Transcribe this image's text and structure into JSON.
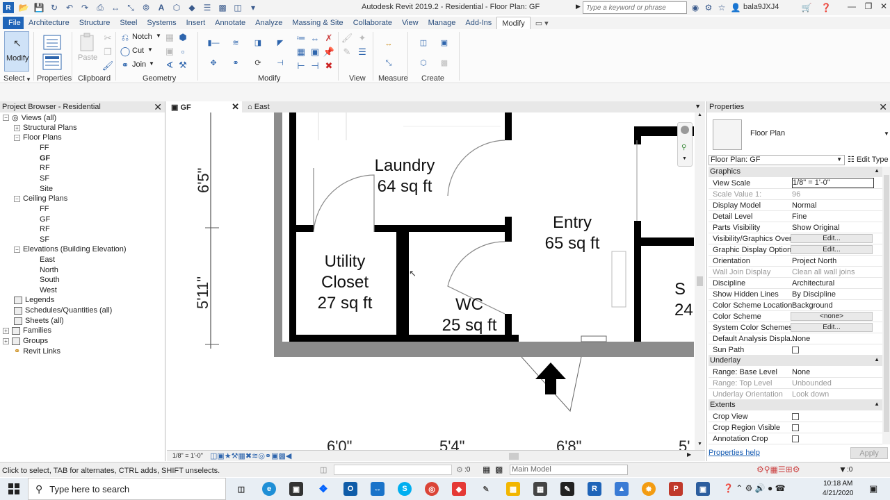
{
  "window": {
    "title": "Autodesk Revit 2019.2 - Residential - Floor Plan: GF",
    "search_placeholder": "Type a keyword or phrase",
    "user": "bala9JXJ4"
  },
  "ribbon": {
    "tabs": [
      "File",
      "Architecture",
      "Structure",
      "Steel",
      "Systems",
      "Insert",
      "Annotate",
      "Analyze",
      "Massing & Site",
      "Collaborate",
      "View",
      "Manage",
      "Add-Ins",
      "Modify"
    ],
    "active_tab": "Modify",
    "modify_label": "Modify",
    "panels": {
      "select": "Select",
      "properties": "Properties",
      "clipboard": "Clipboard",
      "geometry": "Geometry",
      "modify": "Modify",
      "view": "View",
      "measure": "Measure",
      "create": "Create"
    },
    "buttons": {
      "paste": "Paste",
      "notch": "Notch",
      "cut": "Cut",
      "join": "Join"
    }
  },
  "project_browser": {
    "title": "Project Browser - Residential",
    "nodes": [
      {
        "label": "Views (all)"
      },
      {
        "label": "Structural Plans"
      },
      {
        "label": "Floor Plans"
      },
      {
        "label": "FF"
      },
      {
        "label": "GF",
        "active": true
      },
      {
        "label": "RF"
      },
      {
        "label": "SF"
      },
      {
        "label": "Site"
      },
      {
        "label": "Ceiling Plans"
      },
      {
        "label": "FF"
      },
      {
        "label": "GF"
      },
      {
        "label": "RF"
      },
      {
        "label": "SF"
      },
      {
        "label": "Elevations (Building Elevation)"
      },
      {
        "label": "East"
      },
      {
        "label": "North"
      },
      {
        "label": "South"
      },
      {
        "label": "West"
      },
      {
        "label": "Legends"
      },
      {
        "label": "Schedules/Quantities (all)"
      },
      {
        "label": "Sheets (all)"
      },
      {
        "label": "Families"
      },
      {
        "label": "Groups"
      },
      {
        "label": "Revit Links"
      }
    ]
  },
  "doc_tabs": [
    {
      "label": "GF",
      "active": true
    },
    {
      "label": "East",
      "active": false
    }
  ],
  "canvas": {
    "rooms": [
      {
        "name": "Laundry",
        "area": "64 sq ft"
      },
      {
        "name": "Entry",
        "area": "65 sq ft"
      },
      {
        "name": "Utility",
        "name2": "Closet",
        "area": "27 sq ft"
      },
      {
        "name": "WC",
        "area": "25 sq ft"
      },
      {
        "name": "S",
        "area": "24"
      }
    ],
    "dimensions": {
      "v_top": "6'5\"",
      "v_bottom": "5'11\"",
      "h1": "6'0\"",
      "h2": "5'4\"",
      "h3": "6'8\"",
      "h4": "5'"
    }
  },
  "view_control": {
    "scale": "1/8\" = 1'-0\""
  },
  "properties": {
    "title": "Properties",
    "type_name": "Floor Plan",
    "instance": "Floor Plan: GF",
    "edit_type": "Edit Type",
    "groups": [
      {
        "name": "Graphics"
      },
      {
        "name": "Underlay"
      },
      {
        "name": "Extents"
      }
    ],
    "rows": [
      {
        "name": "View Scale",
        "value": "1/8\" = 1'-0\""
      },
      {
        "name": "Scale Value    1:",
        "value": "96"
      },
      {
        "name": "Display Model",
        "value": "Normal"
      },
      {
        "name": "Detail Level",
        "value": "Fine"
      },
      {
        "name": "Parts Visibility",
        "value": "Show Original"
      },
      {
        "name": "Visibility/Graphics Over...",
        "value": "Edit..."
      },
      {
        "name": "Graphic Display Options",
        "value": "Edit..."
      },
      {
        "name": "Orientation",
        "value": "Project North"
      },
      {
        "name": "Wall Join Display",
        "value": "Clean all wall joins"
      },
      {
        "name": "Discipline",
        "value": "Architectural"
      },
      {
        "name": "Show Hidden Lines",
        "value": "By Discipline"
      },
      {
        "name": "Color Scheme Location",
        "value": "Background"
      },
      {
        "name": "Color Scheme",
        "value": "<none>"
      },
      {
        "name": "System Color Schemes",
        "value": "Edit..."
      },
      {
        "name": "Default Analysis Displa...",
        "value": "None"
      },
      {
        "name": "Sun Path",
        "value": ""
      },
      {
        "name": "Range: Base Level",
        "value": "None"
      },
      {
        "name": "Range: Top Level",
        "value": "Unbounded"
      },
      {
        "name": "Underlay Orientation",
        "value": "Look down"
      },
      {
        "name": "Crop View",
        "value": ""
      },
      {
        "name": "Crop Region Visible",
        "value": ""
      },
      {
        "name": "Annotation Crop",
        "value": ""
      }
    ],
    "help": "Properties help",
    "apply": "Apply"
  },
  "status": {
    "text": "Click to select, TAB for alternates, CTRL adds, SHIFT unselects.",
    "zero": ":0",
    "model": "Main Model",
    "filter_count": ":0"
  },
  "taskbar": {
    "search": "Type here to search",
    "time": "10:18 AM",
    "date": "4/21/2020"
  },
  "colors": {
    "file_tab": "#1f64b8",
    "ribbon_icon": "#2e65ad",
    "link": "#1a5fb4"
  }
}
